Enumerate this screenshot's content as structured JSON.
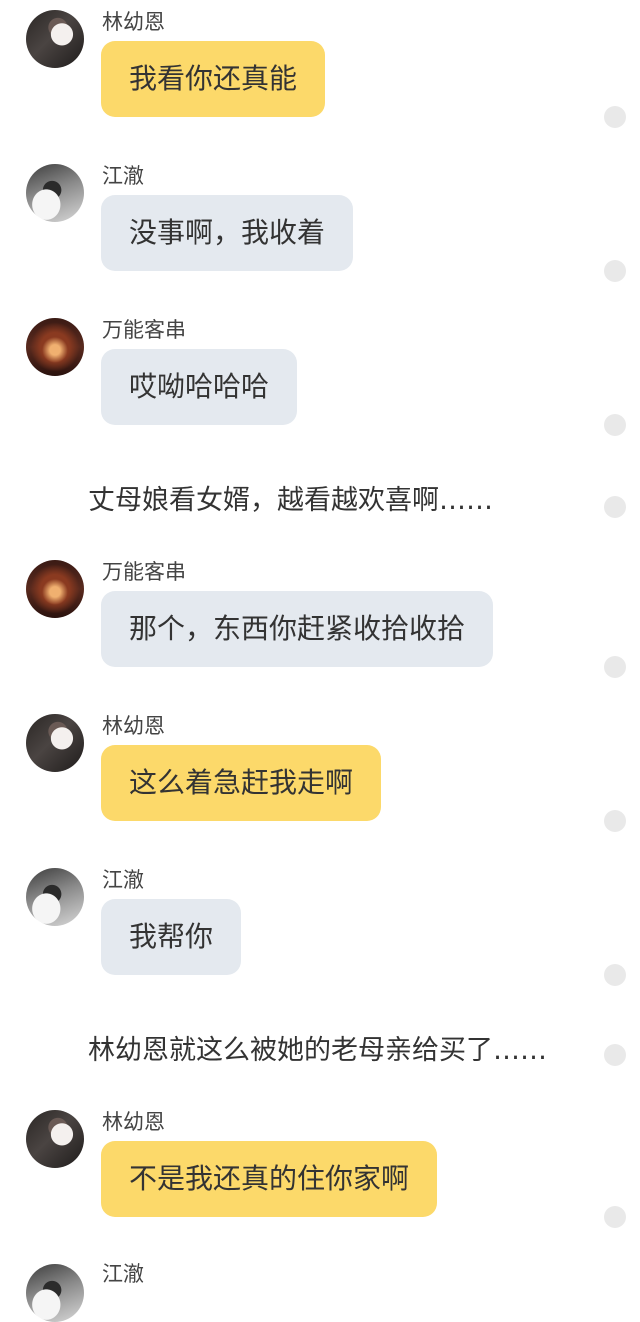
{
  "messages": [
    {
      "sender": "林幼恩",
      "text": "我看你还真能"
    },
    {
      "sender": "江澈",
      "text": "没事啊，我收着"
    },
    {
      "sender": "万能客串",
      "text": "哎呦哈哈哈"
    },
    {
      "narration": "丈母娘看女婿，越看越欢喜啊……"
    },
    {
      "sender": "万能客串",
      "text": "那个，东西你赶紧收拾收拾"
    },
    {
      "sender": "林幼恩",
      "text": "这么着急赶我走啊"
    },
    {
      "sender": "江澈",
      "text": "我帮你"
    },
    {
      "narration": "林幼恩就这么被她的老母亲给买了……"
    },
    {
      "sender": "林幼恩",
      "text": "不是我还真的住你家啊"
    },
    {
      "sender": "江澈"
    }
  ],
  "colors": {
    "lin_bubble": "#fcd96a",
    "other_bubble": "#e4e9ef",
    "background": "#ffffff"
  },
  "icons": {
    "avatar_lin": "girl-photo-avatar",
    "avatar_jiang": "boy-photo-avatar",
    "avatar_wanneng": "galaxy-avatar",
    "action_dot": "circle-dot-icon"
  }
}
